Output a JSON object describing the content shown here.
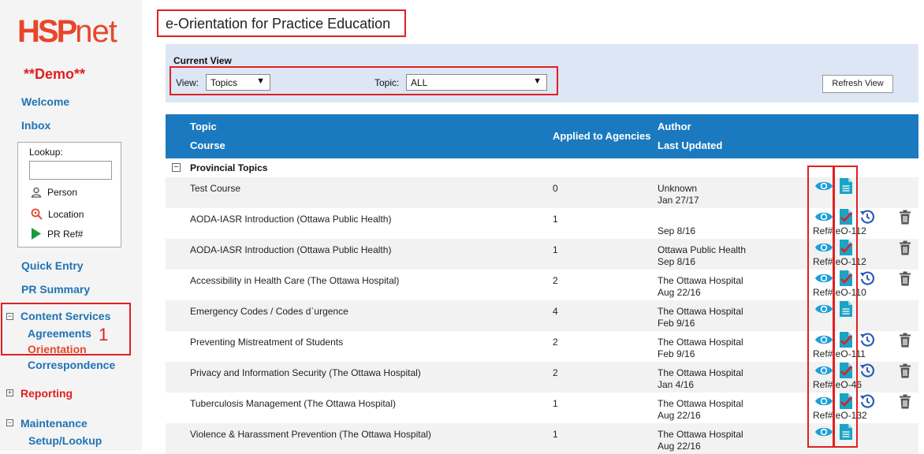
{
  "app": {
    "logo_main": "HSP",
    "logo_suffix": "net",
    "demo_label": "**Demo**"
  },
  "sidebar": {
    "welcome": "Welcome",
    "inbox": "Inbox",
    "lookup": {
      "label": "Lookup:",
      "value": "",
      "person": "Person",
      "location": "Location",
      "pr_ref": "PR Ref#"
    },
    "quick_entry": "Quick Entry",
    "pr_summary": "PR Summary",
    "content_services": "Content Services",
    "agreements": "Agreements",
    "orientation": "Orientation",
    "correspondence": "Correspondence",
    "reporting": "Reporting",
    "maintenance": "Maintenance",
    "setup_lookup": "Setup/Lookup",
    "annotation": "1"
  },
  "page": {
    "title": "e-Orientation for Practice Education"
  },
  "current_view": {
    "title": "Current View",
    "view_label": "View:",
    "view_value": "Topics",
    "topic_label": "Topic:",
    "topic_value": "ALL",
    "refresh_label": "Refresh View"
  },
  "table": {
    "headers": {
      "topic": "Topic",
      "course": "Course",
      "applied": "Applied to Agencies",
      "author": "Author",
      "updated": "Last Updated"
    },
    "group_label": "Provincial Topics",
    "rows": [
      {
        "course": "Test Course",
        "applied": "0",
        "author": "Unknown",
        "updated": "Jan 27/17",
        "ref": "",
        "history": false,
        "trash": false,
        "doc": "plain"
      },
      {
        "course": "AODA-IASR Introduction (Ottawa Public Health)",
        "applied": "1",
        "author": "",
        "updated": "Sep 8/16",
        "ref": "Ref# eO-112",
        "history": true,
        "trash": true,
        "doc": "checked"
      },
      {
        "course": "AODA-IASR Introduction (Ottawa Public Health)",
        "applied": "1",
        "author": "Ottawa Public Health",
        "updated": "Sep 8/16",
        "ref": "Ref# eO-112",
        "history": false,
        "trash": true,
        "doc": "checked"
      },
      {
        "course": "Accessibility in Health Care (The Ottawa Hospital)",
        "applied": "2",
        "author": "The Ottawa Hospital",
        "updated": "Aug 22/16",
        "ref": "Ref# eO-110",
        "history": true,
        "trash": true,
        "doc": "checked"
      },
      {
        "course": "Emergency Codes / Codes d`urgence",
        "applied": "4",
        "author": "The Ottawa Hospital",
        "updated": "Feb 9/16",
        "ref": "",
        "history": false,
        "trash": false,
        "doc": "plain"
      },
      {
        "course": "Preventing Mistreatment of Students",
        "applied": "2",
        "author": "The Ottawa Hospital",
        "updated": "Feb 9/16",
        "ref": "Ref# eO-111",
        "history": true,
        "trash": true,
        "doc": "checked"
      },
      {
        "course": "Privacy and Information Security (The Ottawa Hospital)",
        "applied": "2",
        "author": "The Ottawa Hospital",
        "updated": "Jan 4/16",
        "ref": "Ref# eO-46",
        "history": true,
        "trash": true,
        "doc": "checked"
      },
      {
        "course": "Tuberculosis Management (The Ottawa Hospital)",
        "applied": "1",
        "author": "The Ottawa Hospital",
        "updated": "Aug 22/16",
        "ref": "Ref# eO-132",
        "history": true,
        "trash": true,
        "doc": "checked"
      },
      {
        "course": "Violence & Harassment Prevention (The Ottawa Hospital)",
        "applied": "1",
        "author": "The Ottawa Hospital",
        "updated": "Aug 22/16",
        "ref": "",
        "history": false,
        "trash": false,
        "doc": "plain"
      }
    ]
  },
  "colors": {
    "brand": "#e8452a",
    "link": "#1e73b5",
    "header": "#1b7abf",
    "highlight": "#e02020",
    "icon": "#1f9fd8",
    "doc": "#1aa3c7"
  }
}
